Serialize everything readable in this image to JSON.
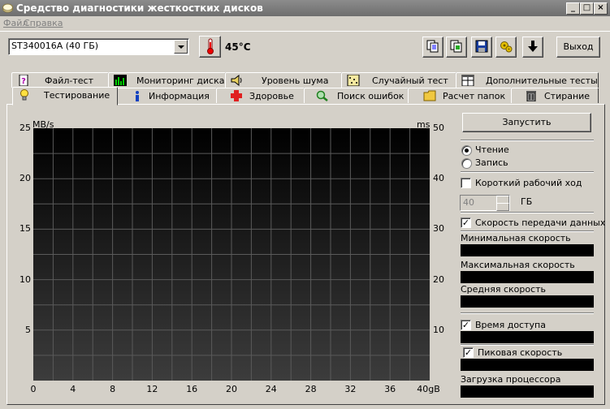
{
  "window": {
    "title": "Средство диагностики жесткостких дисков"
  },
  "menu": {
    "items": [
      "Файл",
      "Справка"
    ]
  },
  "toolbar": {
    "drive_value": "ST340016A (40 ГБ)",
    "temperature": "45°C",
    "exit_label": "Выход"
  },
  "tabs_row1": [
    "Файл-тест",
    "Мониторинг диска",
    "Уровень шума",
    "Случайный тест",
    "Дополнительные тесты"
  ],
  "tabs_row2": [
    "Тестирование",
    "Информация",
    "Здоровье",
    "Поиск ошибок",
    "Расчет папок",
    "Стирание"
  ],
  "chart_data": {
    "type": "line",
    "y_left_label": "MB/s",
    "y_right_label": "ms",
    "y_left_ticks": [
      "25",
      "20",
      "15",
      "10",
      "5"
    ],
    "y_right_ticks": [
      "50",
      "40",
      "30",
      "20",
      "10"
    ],
    "x_ticks": [
      "0",
      "4",
      "8",
      "12",
      "16",
      "20",
      "24",
      "28",
      "32",
      "36",
      "40gB"
    ],
    "y_left_range": [
      0,
      25
    ],
    "y_right_range": [
      0,
      50
    ],
    "x_range": [
      0,
      40
    ],
    "series": [],
    "grid": true
  },
  "side": {
    "start_label": "Запустить",
    "read_label": "Чтение",
    "write_label": "Запись",
    "short_stroke_label": "Короткий рабочий ход",
    "short_stroke_value": "40",
    "gb_label": "ГБ",
    "transfer_rate_label": "Скорость передачи данных",
    "min_speed_label": "Минимальная скорость",
    "max_speed_label": "Максимальная скорость",
    "avg_speed_label": "Средняя скорость",
    "access_time_label": "Время доступа",
    "burst_rate_label": "Пиковая скорость",
    "cpu_label": "Загрузка процессора"
  },
  "colors": {
    "chart_bg_top": "#000000",
    "chart_bg_bottom": "#3a3a3a",
    "grid": "#5a5a5a"
  }
}
